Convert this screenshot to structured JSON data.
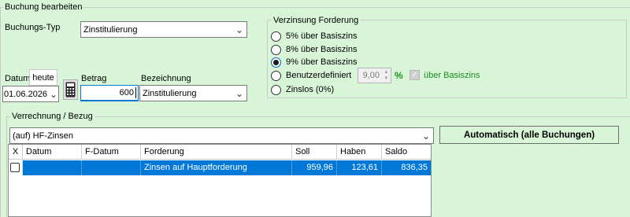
{
  "outer_group": {
    "title": "Buchung bearbeiten"
  },
  "buchung": {
    "typ_label": "Buchungs-Typ",
    "typ_value": "Zinstitulierung",
    "datum_label": "Datum",
    "heute_button": "heute",
    "datum_value": "01.06.2026",
    "betrag_label": "Betrag",
    "betrag_value": "600",
    "bezeichnung_label": "Bezeichnung",
    "bezeichnung_value": "Zinstitulierung",
    "calculator_icon": "calculator-icon"
  },
  "verzinsung": {
    "title": "Verzinsung Forderung",
    "options": [
      {
        "label": "5% über Basiszins",
        "selected": false
      },
      {
        "label": "8% über Basiszins",
        "selected": false
      },
      {
        "label": "9% über Basiszins",
        "selected": true
      },
      {
        "label": "Benutzerdefiniert",
        "selected": false
      },
      {
        "label": "Zinslos (0%)",
        "selected": false
      }
    ],
    "custom_value": "9,00",
    "percent_sign": "%",
    "ueber_basiszins_label": "über Basiszins",
    "ueber_basiszins_checked": true,
    "accent_color": "#1e8c1e"
  },
  "verrechnung": {
    "title": "Verrechnung / Bezug",
    "bezug_value": "(auf) HF-Zinsen",
    "auto_button": "Automatisch (alle Buchungen)",
    "columns": [
      "X",
      "Datum",
      "F-Datum",
      "Forderung",
      "Soll",
      "Haben",
      "Saldo"
    ],
    "rows": [
      {
        "x": false,
        "datum": "",
        "f_datum": "",
        "forderung": "Zinsen auf Hauptforderung",
        "soll": "959,96",
        "haben": "123,61",
        "saldo": "836,35"
      }
    ],
    "selection_color": "#0078d7"
  }
}
